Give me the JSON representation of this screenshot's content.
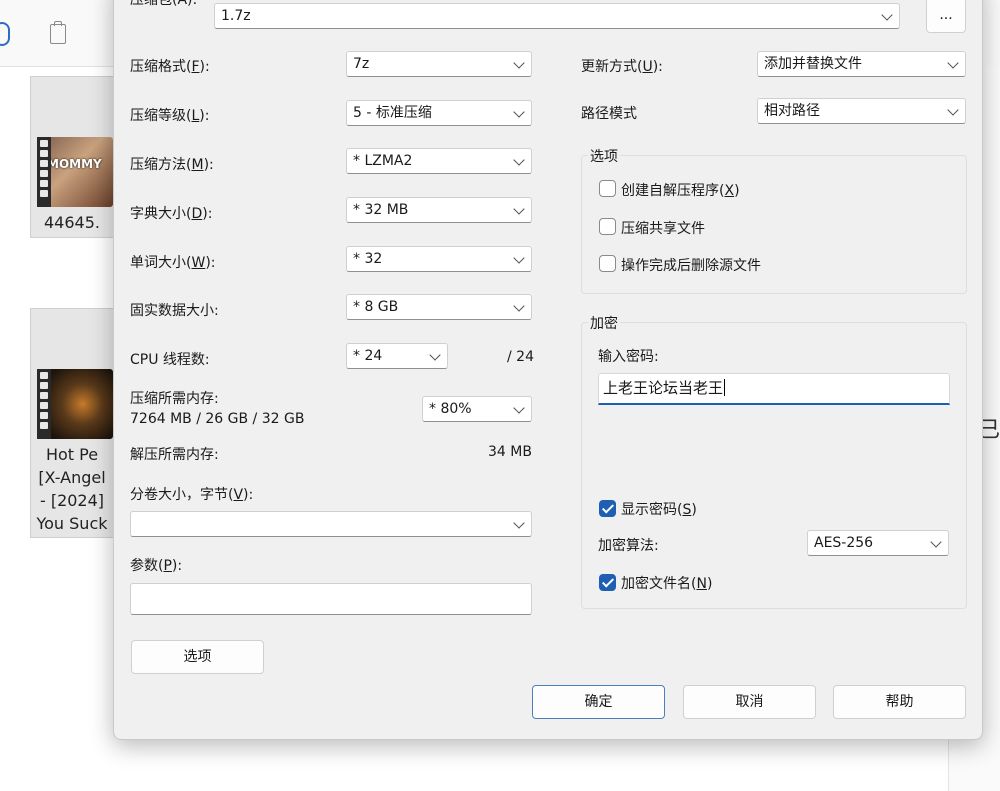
{
  "background": {
    "tile1_label": "44645.",
    "tile2_lines": [
      "Hot Pe",
      "[X-Angel",
      "- [2024]",
      "You Suck"
    ],
    "tile1_thumb_text": "MOMMY",
    "right_partial_char": "已"
  },
  "dialog": {
    "archive": {
      "label": "压缩包(A):",
      "value": "1.7z",
      "browse_label": "..."
    },
    "left": {
      "format": {
        "label_pre": "压缩格式(",
        "key": "F",
        "label_post": "):",
        "value": "7z"
      },
      "level": {
        "label_pre": "压缩等级(",
        "key": "L",
        "label_post": "):",
        "value": "5 - 标准压缩"
      },
      "method": {
        "label_pre": "压缩方法(",
        "key": "M",
        "label_post": "):",
        "value": "*  LZMA2"
      },
      "dict": {
        "label_pre": "字典大小(",
        "key": "D",
        "label_post": "):",
        "value": "*  32 MB"
      },
      "word": {
        "label_pre": "单词大小(",
        "key": "W",
        "label_post": "):",
        "value": "*  32"
      },
      "solid": {
        "label": "固实数据大小:",
        "value": "*  8 GB"
      },
      "cpu": {
        "label": "CPU 线程数:",
        "value": "*  24",
        "max": "/ 24"
      },
      "mem_compress": {
        "label": "压缩所需内存:",
        "detail": "7264 MB / 26 GB / 32 GB",
        "value": "*  80%"
      },
      "mem_decompress": {
        "label": "解压所需内存:",
        "value": "34 MB"
      },
      "volume": {
        "label_pre": "分卷大小，字节(",
        "key": "V",
        "label_post": "):",
        "value": ""
      },
      "params": {
        "label_pre": "参数(",
        "key": "P",
        "label_post": "):",
        "value": ""
      },
      "options_button": "选项"
    },
    "right": {
      "update": {
        "label_pre": "更新方式(",
        "key": "U",
        "label_post": "):",
        "value": "添加并替换文件"
      },
      "path": {
        "label": "路径模式",
        "value": "相对路径"
      },
      "options_group": {
        "title": "选项",
        "sfx": {
          "label_pre": "创建自解压程序(",
          "key": "X",
          "label_post": ")",
          "checked": false
        },
        "shared": {
          "label": "压缩共享文件",
          "checked": false
        },
        "delete": {
          "label": "操作完成后删除源文件",
          "checked": false
        }
      },
      "encryption": {
        "title": "加密",
        "password_label": "输入密码:",
        "password_value": "上老王论坛当老王",
        "show_password": {
          "label_pre": "显示密码(",
          "key": "S",
          "label_post": ")",
          "checked": true
        },
        "method_label": "加密算法:",
        "method_value": "AES-256",
        "encrypt_names": {
          "label_pre": "加密文件名(",
          "key": "N",
          "label_post": ")",
          "checked": true
        }
      }
    },
    "buttons": {
      "ok": "确定",
      "cancel": "取消",
      "help": "帮助"
    }
  }
}
